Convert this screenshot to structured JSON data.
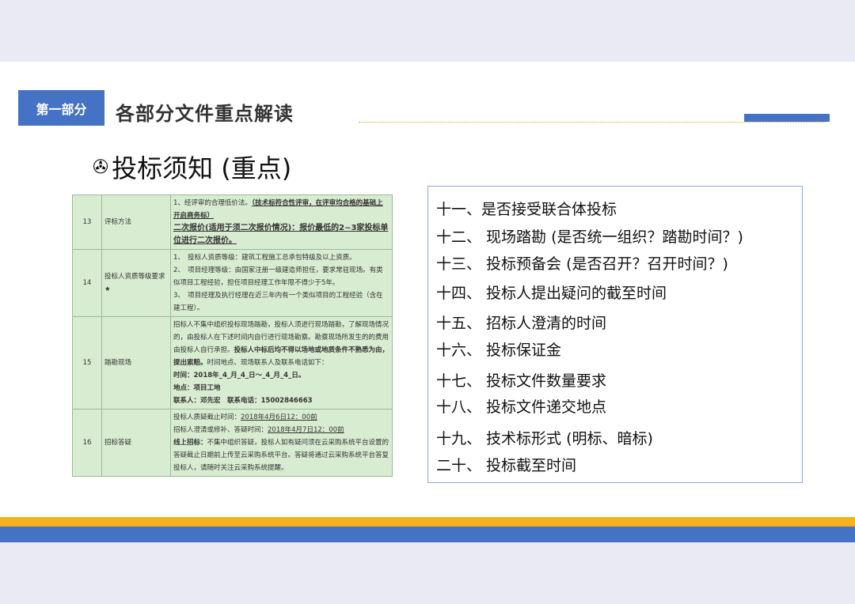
{
  "section": {
    "tag": "第一部分",
    "title": "各部分文件重点解读"
  },
  "heading": {
    "icon": "✇",
    "text": "投标须知 (重点)"
  },
  "table_rows": [
    {
      "no": "13",
      "item": "评标方法",
      "lines": [
        {
          "segs": [
            {
              "t": "1、经评审的合理低价法。",
              "s": ""
            },
            {
              "t": "（技术标符合性评审，在评审均合格的基础上开启商务标）",
              "s": "b u"
            }
          ]
        },
        {
          "segs": [
            {
              "t": "二次报价(适用于须二次报价情况)：报价最低的2~3家投标单位进行二次报价。",
              "s": "b u b2"
            }
          ]
        }
      ]
    },
    {
      "no": "14",
      "item": "投标人资质等级要求★",
      "lines": [
        {
          "segs": [
            {
              "t": "1、　投标人资质等级：建筑工程施工总承包特级及以上资质。",
              "s": ""
            }
          ]
        },
        {
          "segs": [
            {
              "t": "2、　项目经理等级：由国家注册一级建造师担任，要求常驻现场。有类似项目工程经验，担任项目经理工作年限不得少于5年。",
              "s": ""
            }
          ]
        },
        {
          "segs": [
            {
              "t": "3、　项目经理及执行经理在近三年内有一个类似项目的工程经验（含在建工程）。",
              "s": ""
            }
          ]
        }
      ]
    },
    {
      "no": "15",
      "item": "踏勘现场",
      "lines": [
        {
          "segs": [
            {
              "t": "招标人不集中组织投标现场踏勘，投标人须进行现场踏勘，了解现场情况的，由投标人在下述时间内自行进行现场勘察。勘察现场所发生的的费用由投标人自行承担。",
              "s": ""
            },
            {
              "t": "投标人中标后均不得以场地或地质条件不熟悉为由，提出索赔。",
              "s": "b"
            },
            {
              "t": "时间地点、现场联系人及联系电话如下：",
              "s": ""
            }
          ]
        },
        {
          "segs": [
            {
              "t": "时间：2018年_4_月_4_日～_4_月_4_日。",
              "s": "b"
            }
          ]
        },
        {
          "segs": [
            {
              "t": "地点：项目工地",
              "s": "b"
            }
          ]
        },
        {
          "segs": [
            {
              "t": "联系人：邓先宏　联系电话：15002846663",
              "s": "b"
            }
          ]
        }
      ]
    },
    {
      "no": "16",
      "item": "招标答疑",
      "lines": [
        {
          "segs": [
            {
              "t": "投标人质疑截止时间：",
              "s": ""
            },
            {
              "t": "2018年4月6日12：00前",
              "s": "u"
            }
          ]
        },
        {
          "segs": [
            {
              "t": "招标人澄清或修补、答疑时间：",
              "s": ""
            },
            {
              "t": "2018年4月7日12：00前",
              "s": "u"
            }
          ]
        },
        {
          "segs": [
            {
              "t": "线上招标：",
              "s": "b"
            },
            {
              "t": "不集中组织答疑，投标人如有疑问须在云采购系统平台设置的答疑截止日期前上传至云采购系统平台。答疑将通过云采购系统平台答复投标人，请随时关注云采购系统提醒。",
              "s": ""
            }
          ]
        }
      ]
    }
  ],
  "list_items": [
    "十一、是否接受联合体投标",
    "十二、 现场踏勘 (是否统一组织？踏勘时间？)",
    "十三、 投标预备会 (是否召开？召开时间？)",
    "十四、 投标人提出疑问的截至时间",
    "十五、 招标人澄清的时间",
    "十六、 投标保证金",
    "十七、 投标文件数量要求",
    "十八、 投标文件递交地点",
    "十九、 技术标形式 (明标、暗标)",
    "二十、 投标截至时间"
  ],
  "colors": {
    "blue": "#4472c4",
    "orange": "#f5b21a",
    "table_bg": "#d8ecd1"
  }
}
